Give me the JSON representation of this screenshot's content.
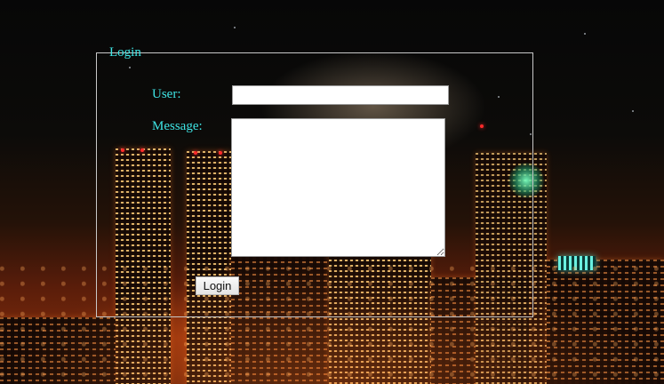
{
  "background": {
    "description_icon": "city-skyline-night-image",
    "sky_color": "#070707",
    "glow_color": "#7a2a0c"
  },
  "form": {
    "legend": "Login",
    "user_label": "User:",
    "user_value": "",
    "message_label": "Message:",
    "message_value": "",
    "submit_label": "Login",
    "label_color": "#3fe5e5",
    "border_color": "#c8c8c8"
  }
}
